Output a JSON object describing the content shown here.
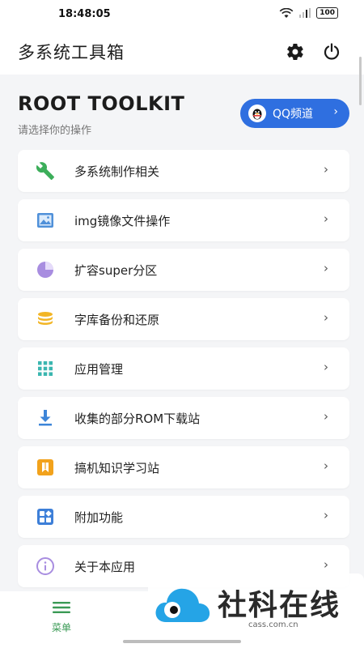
{
  "status_bar": {
    "time": "18:48:05",
    "battery": "100"
  },
  "app_bar": {
    "title": "多系统工具箱"
  },
  "header": {
    "title": "ROOT TOOLKIT",
    "subtitle": "请选择你的操作",
    "qq_button_label": "QQ频道",
    "qq_button_chevron": "›"
  },
  "menu": {
    "items": [
      {
        "label": "多系统制作相关",
        "icon": "wrench-icon",
        "color": "#3cae5a"
      },
      {
        "label": "img镜像文件操作",
        "icon": "image-icon",
        "color": "#4f90d9"
      },
      {
        "label": "扩容super分区",
        "icon": "pie-chart-icon",
        "color": "#a88de0"
      },
      {
        "label": "字库备份和还原",
        "icon": "database-icon",
        "color": "#f2b525"
      },
      {
        "label": "应用管理",
        "icon": "apps-grid-icon",
        "color": "#3bb6b0"
      },
      {
        "label": "收集的部分ROM下载站",
        "icon": "download-icon",
        "color": "#3d85d8"
      },
      {
        "label": "搞机知识学习站",
        "icon": "book-icon",
        "color": "#f2a21c"
      },
      {
        "label": "附加功能",
        "icon": "widgets-icon",
        "color": "#3d7fd8"
      },
      {
        "label": "关于本应用",
        "icon": "info-icon",
        "color": "#a88de0"
      }
    ],
    "chevron": "›"
  },
  "bottom_nav": {
    "label": "菜单"
  },
  "watermark": {
    "text": "社科在线",
    "url": "cass.com.cn"
  }
}
